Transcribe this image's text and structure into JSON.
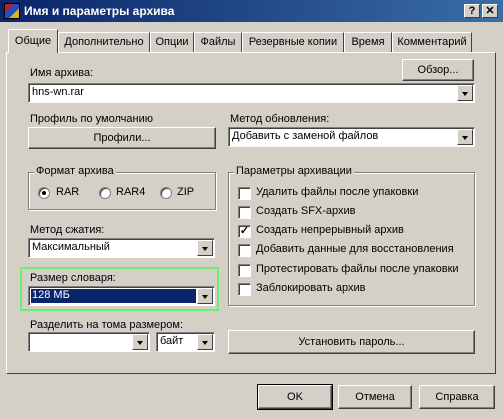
{
  "window": {
    "title": "Имя и параметры архива",
    "help_btn": "?",
    "close_btn": "✕"
  },
  "tabs": [
    "Общие",
    "Дополнительно",
    "Опции",
    "Файлы",
    "Резервные копии",
    "Время",
    "Комментарий"
  ],
  "archive_name": {
    "label": "Имя архива:",
    "value": "hns-wn.rar",
    "browse_button": "Обзор..."
  },
  "profile": {
    "label": "Профиль по умолчанию",
    "button": "Профили..."
  },
  "update_method": {
    "label": "Метод обновления:",
    "value": "Добавить с заменой файлов"
  },
  "format": {
    "title": "Формат архива",
    "options": [
      "RAR",
      "RAR4",
      "ZIP"
    ],
    "selected": "RAR"
  },
  "compression": {
    "label": "Метод сжатия:",
    "value": "Максимальный"
  },
  "dictionary": {
    "label": "Размер словаря:",
    "value": "128 МБ"
  },
  "split": {
    "label": "Разделить на тома размером:",
    "value": "",
    "unit": "байт"
  },
  "options": {
    "title": "Параметры архивации",
    "items": [
      {
        "label": "Удалить файлы после упаковки",
        "checked": false
      },
      {
        "label": "Создать SFX-архив",
        "checked": false
      },
      {
        "label": "Создать непрерывный архив",
        "checked": true
      },
      {
        "label": "Добавить данные для восстановления",
        "checked": false
      },
      {
        "label": "Протестировать файлы после упаковки",
        "checked": false
      },
      {
        "label": "Заблокировать архив",
        "checked": false
      }
    ]
  },
  "password_button": "Установить пароль...",
  "footer": {
    "ok": "OK",
    "cancel": "Отмена",
    "help": "Справка"
  },
  "colors": {
    "highlight": "#6ef06e",
    "selection": "#0a246a",
    "titlebar": "#0a246a"
  }
}
